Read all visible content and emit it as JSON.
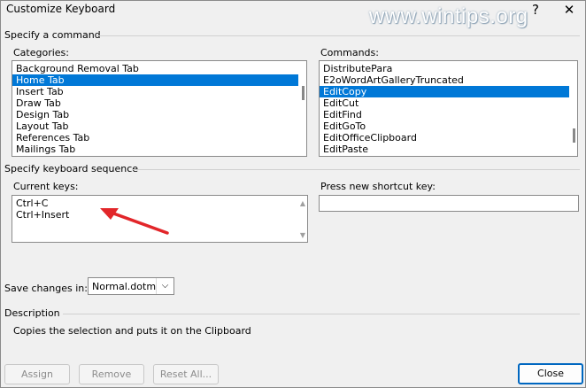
{
  "window": {
    "title": "Customize Keyboard",
    "watermark": "www.wintips.org",
    "help": "?",
    "close_glyph": "✕"
  },
  "specify_command": {
    "heading": "Specify a command",
    "categories_label": "Categories:",
    "categories": [
      "Background Removal Tab",
      "Home Tab",
      "Insert Tab",
      "Draw Tab",
      "Design Tab",
      "Layout Tab",
      "References Tab",
      "Mailings Tab"
    ],
    "categories_selected": 1,
    "commands_label": "Commands:",
    "commands": [
      "DistributePara",
      "E2oWordArtGalleryTruncated",
      "EditCopy",
      "EditCut",
      "EditFind",
      "EditGoTo",
      "EditOfficeClipboard",
      "EditPaste"
    ],
    "commands_selected": 2
  },
  "keyboard_sequence": {
    "heading": "Specify keyboard sequence",
    "current_keys_label": "Current keys:",
    "current_keys": [
      "Ctrl+C",
      "Ctrl+Insert"
    ],
    "new_key_label": "Press new shortcut key:",
    "new_key_value": ""
  },
  "save_changes": {
    "label": "Save changes in:",
    "value": "Normal.dotm"
  },
  "description": {
    "heading": "Description",
    "text": "Copies the selection and puts it on the Clipboard"
  },
  "buttons": {
    "assign": "Assign",
    "remove": "Remove",
    "reset_all": "Reset All...",
    "close": "Close"
  },
  "colors": {
    "selection": "#0078d7",
    "annotation_arrow": "#e2262a",
    "primary_border": "#0067c0"
  },
  "annotation": {
    "type": "red-arrow",
    "points_to": "current-keys-list"
  }
}
